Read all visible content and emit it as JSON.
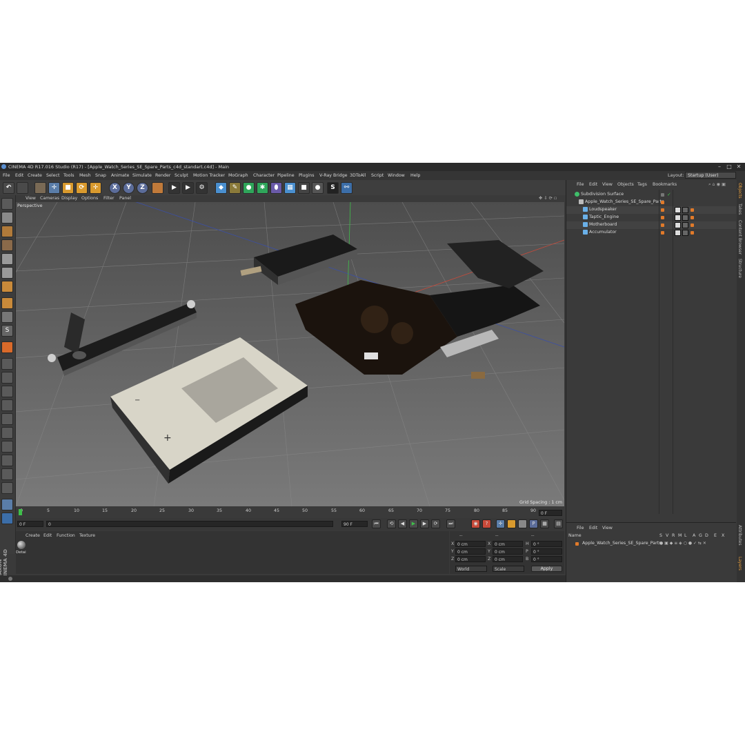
{
  "window": {
    "title": "CINEMA 4D R17.016 Studio (R17) - [Apple_Watch_Series_SE_Spare_Parts_c4d_standart.c4d] - Main",
    "minimize": "–",
    "maximize": "□",
    "close": "✕"
  },
  "menu": [
    "File",
    "Edit",
    "Create",
    "Select",
    "Tools",
    "Mesh",
    "Snap",
    "Animate",
    "Simulate",
    "Render",
    "Sculpt",
    "Motion Tracker",
    "MoGraph",
    "Character",
    "Pipeline",
    "Plugins",
    "V-Ray Bridge",
    "3DToAll",
    "Script",
    "Window",
    "Help"
  ],
  "layout": {
    "label": "Layout:",
    "value": "Startup (User)"
  },
  "toolbar": {
    "axis_x": "X",
    "axis_y": "Y",
    "axis_z": "Z"
  },
  "viewport": {
    "menu": [
      "View",
      "Cameras",
      "Display",
      "Options",
      "Filter",
      "Panel"
    ],
    "label": "Perspective",
    "grid_spacing": "Grid Spacing : 1 cm"
  },
  "timeline": {
    "ticks": [
      "0",
      "5",
      "10",
      "15",
      "20",
      "25",
      "30",
      "35",
      "40",
      "45",
      "50",
      "55",
      "60",
      "65",
      "70",
      "75",
      "80",
      "85",
      "90"
    ],
    "current_frame": "0 F"
  },
  "transport": {
    "start": "0 F",
    "min_field": "0",
    "end_field": "90 F",
    "max": "90 F"
  },
  "material_manager": {
    "menu": [
      "Create",
      "Edit",
      "Function",
      "Texture"
    ],
    "material_name": "Detai"
  },
  "coordinates": {
    "headers": [
      "--",
      "--",
      "--"
    ],
    "rows": [
      {
        "a": "X",
        "av": "0 cm",
        "b": "X",
        "bv": "0 cm",
        "c": "H",
        "cv": "0 °"
      },
      {
        "a": "Y",
        "av": "0 cm",
        "b": "Y",
        "bv": "0 cm",
        "c": "P",
        "cv": "0 °"
      },
      {
        "a": "Z",
        "av": "0 cm",
        "b": "Z",
        "bv": "0 cm",
        "c": "B",
        "cv": "0 °"
      }
    ],
    "mode1": "World",
    "mode2": "Scale",
    "apply": "Apply"
  },
  "object_manager": {
    "menu": [
      "File",
      "Edit",
      "View",
      "Objects",
      "Tags",
      "Bookmarks"
    ],
    "objects": [
      {
        "name": "Subdivision Surface",
        "icon_color": "#3fbf6a"
      },
      {
        "name": "Apple_Watch_Series_SE_Spare_Parts",
        "icon_color": "#bbbbbb"
      },
      {
        "name": "Loudspeaker",
        "icon_color": "#6ab0e8"
      },
      {
        "name": "Taptic_Engine",
        "icon_color": "#6ab0e8"
      },
      {
        "name": "Motherboard",
        "icon_color": "#6ab0e8"
      },
      {
        "name": "Accumulator",
        "icon_color": "#6ab0e8"
      }
    ]
  },
  "layer_manager": {
    "menu": [
      "File",
      "Edit",
      "View"
    ],
    "header_name": "Name",
    "header_cols": [
      "S",
      "V",
      "R",
      "M",
      "L",
      "A",
      "G",
      "D",
      "E",
      "X"
    ],
    "layer_name": "Apple_Watch_Series_SE_Spare_Parts"
  },
  "side_tabs": [
    "Objects",
    "Takes",
    "Content Browser",
    "Structure",
    "Attributes",
    "Layers"
  ],
  "brand": "MAXON CINEMA 4D"
}
